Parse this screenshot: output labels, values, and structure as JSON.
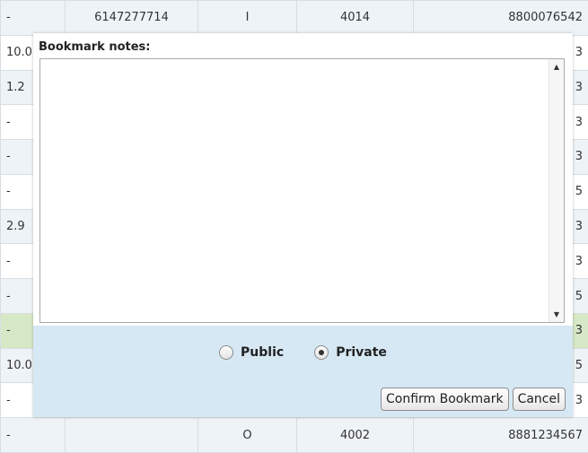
{
  "background_table": {
    "rows": [
      [
        "-",
        "6147277714",
        "I",
        "4014",
        "8800076542"
      ],
      [
        "10.0",
        "",
        "",
        "",
        "3"
      ],
      [
        "1.2",
        "",
        "",
        "",
        "3"
      ],
      [
        "-",
        "",
        "",
        "",
        "3"
      ],
      [
        "-",
        "",
        "",
        "",
        "3"
      ],
      [
        "-",
        "",
        "",
        "",
        "5"
      ],
      [
        "2.9",
        "",
        "",
        "",
        "3"
      ],
      [
        "-",
        "",
        "",
        "",
        "3"
      ],
      [
        "-",
        "",
        "",
        "",
        "5"
      ],
      [
        "-",
        "",
        "",
        "",
        "3"
      ],
      [
        "10.0",
        "",
        "",
        "",
        "5"
      ],
      [
        "-",
        "",
        "",
        "",
        "3"
      ],
      [
        "-",
        "",
        "O",
        "4002",
        "8881234567"
      ]
    ]
  },
  "dialog": {
    "notes_label": "Bookmark notes:",
    "notes_value": "",
    "visibility": {
      "options": [
        {
          "label": "Public",
          "checked": false
        },
        {
          "label": "Private",
          "checked": true
        }
      ]
    },
    "confirm_label": "Confirm Bookmark",
    "cancel_label": "Cancel"
  },
  "icons": {
    "scroll_up": "scroll-up-arrow-icon",
    "scroll_down": "scroll-down-arrow-icon"
  },
  "colors": {
    "dialog_footer": "#d6e8f4",
    "row_highlight": "#d7e8c7"
  }
}
